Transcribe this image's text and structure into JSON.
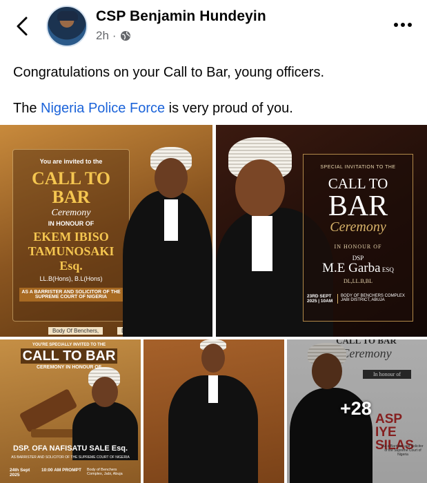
{
  "post": {
    "author": "CSP Benjamin Hundeyin",
    "time": "2h",
    "separator": "·",
    "line1": "Congratulations on your Call to Bar, young officers.",
    "line2_pre": "The ",
    "line2_link": "Nigeria Police Force",
    "line2_post": " is very proud of you.",
    "more_photos": "+28"
  },
  "photos": {
    "p1": {
      "invite": "You are invited to the",
      "title": "CALL TO BAR",
      "script": "Ceremony",
      "honour": "IN HONOUR OF",
      "name": "EKEM IBISO TAMUNOSAKI",
      "suffix": "Esq.",
      "degrees": "LL.B(Hons), B.L(Hons)",
      "role": "AS A BARRISTER AND SOLICITOR OF THE SUPREME COURT OF NIGERIA",
      "venue": "Body Of Benchers,",
      "date_label": "Date:"
    },
    "p2": {
      "invite": "SPECIAL INVITATION TO THE",
      "title1": "CALL TO",
      "title2": "BAR",
      "script": "Ceremony",
      "honour": "IN HONOUR OF",
      "rank": "DSP",
      "name": "M.E Garba",
      "suffix": "ESQ",
      "degrees": "DL,LL.B,BL",
      "date": "23RD SEPT 2025 | 10AM",
      "venue": "BODY OF BENCHERS COMPLEX JABI DISTRICT, ABUJA"
    },
    "p3": {
      "invite": "YOU'RE SPECIALLY INVITED TO THE",
      "title": "CALL TO BAR",
      "sub": "CEREMONY IN HONOUR OF",
      "name": "DSP. OFA NAFISATU SALE Esq.",
      "role": "AS BARRISTER AND SOLICITOR OF THE SUPREME COURT OF NIGERIA",
      "date": "24th Sept 2025",
      "time": "10:00 AM PROMPT",
      "venue": "Body of Benchers Complex, Jabi, Abuja"
    },
    "p5": {
      "title": "CALL TO BAR",
      "script": "Ceremony",
      "honour": "In honour of",
      "name": "ASP IYE SILAS",
      "role": "As a Barrister and Solicitor of the Supreme Court of Nigeria"
    }
  },
  "icons": {
    "back": "chevron-left-icon",
    "globe": "globe-icon",
    "more": "more-horizontal-icon"
  },
  "colors": {
    "link": "#1b63d9",
    "meta": "#65676b",
    "gold": "#f5c650"
  }
}
